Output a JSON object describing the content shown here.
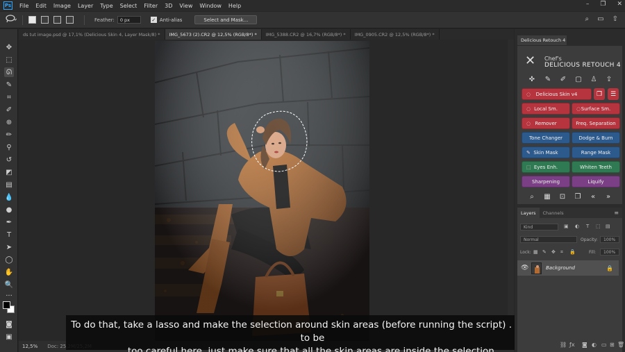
{
  "app": {
    "logo": "Ps"
  },
  "menu": [
    "File",
    "Edit",
    "Image",
    "Layer",
    "Type",
    "Select",
    "Filter",
    "3D",
    "View",
    "Window",
    "Help"
  ],
  "window_controls": [
    "–",
    "❐",
    "✕"
  ],
  "options": {
    "feather_label": "Feather:",
    "feather_value": "0 px",
    "antialias_label": "Anti-alias",
    "antialias_checked": true,
    "select_mask_label": "Select and Mask..."
  },
  "tabs": [
    {
      "label": "ds tut image.psd @ 17,1% (Delicious Skin 4, Layer Mask/8) *",
      "active": false
    },
    {
      "label": "IMG_5673 (2).CR2 @ 12,5% (RGB/8*) *",
      "active": true
    },
    {
      "label": "IMG_5388.CR2 @ 16,7% (RGB/8*) *",
      "active": false
    },
    {
      "label": "IMG_0905.CR2 @ 12,5% (RGB/8*) *",
      "active": false
    }
  ],
  "status": {
    "zoom": "12,5%",
    "doc": "Doc: 25,2M/25,2M"
  },
  "caption": {
    "line1": "To do that, take a lasso and make the selection around skin areas (before running the script) . No need to be",
    "line2": "too careful here, just make sure that all the skin areas are inside the selection."
  },
  "retouch_panel": {
    "tab_label": "Delicious Retouch 4",
    "logo_line1": "Chef's",
    "logo_line2": "DELICIOUS RETOUCH 4",
    "buttons": {
      "delicious_skin": "Delicious Skin v4",
      "local_sm": "Local Sm.",
      "surface_sm": "Surface Sm.",
      "remover": "Remover",
      "freq_separation": "Freq. Separation",
      "tone_changer": "Tone Changer",
      "dodge_burn": "Dodge & Burn",
      "skin_mask": "Skin Mask",
      "range_mask": "Range Mask",
      "eyes_enh": "Eyes Enh.",
      "whiten_teeth": "Whiten Teeth",
      "sharpening": "Sharpening",
      "liquify": "Liquify"
    },
    "colors": {
      "red": "#b5343e",
      "blue": "#2c5a8c",
      "green": "#2f7a52",
      "purple": "#7b3f86"
    }
  },
  "layers_panel": {
    "tabs": [
      "Layers",
      "Channels"
    ],
    "kind_label": "Kind",
    "blend_mode": "Normal",
    "opacity_label": "Opacity:",
    "opacity_value": "100%",
    "lock_label": "Lock:",
    "fill_label": "Fill:",
    "fill_value": "100%",
    "layer_name": "Background"
  }
}
